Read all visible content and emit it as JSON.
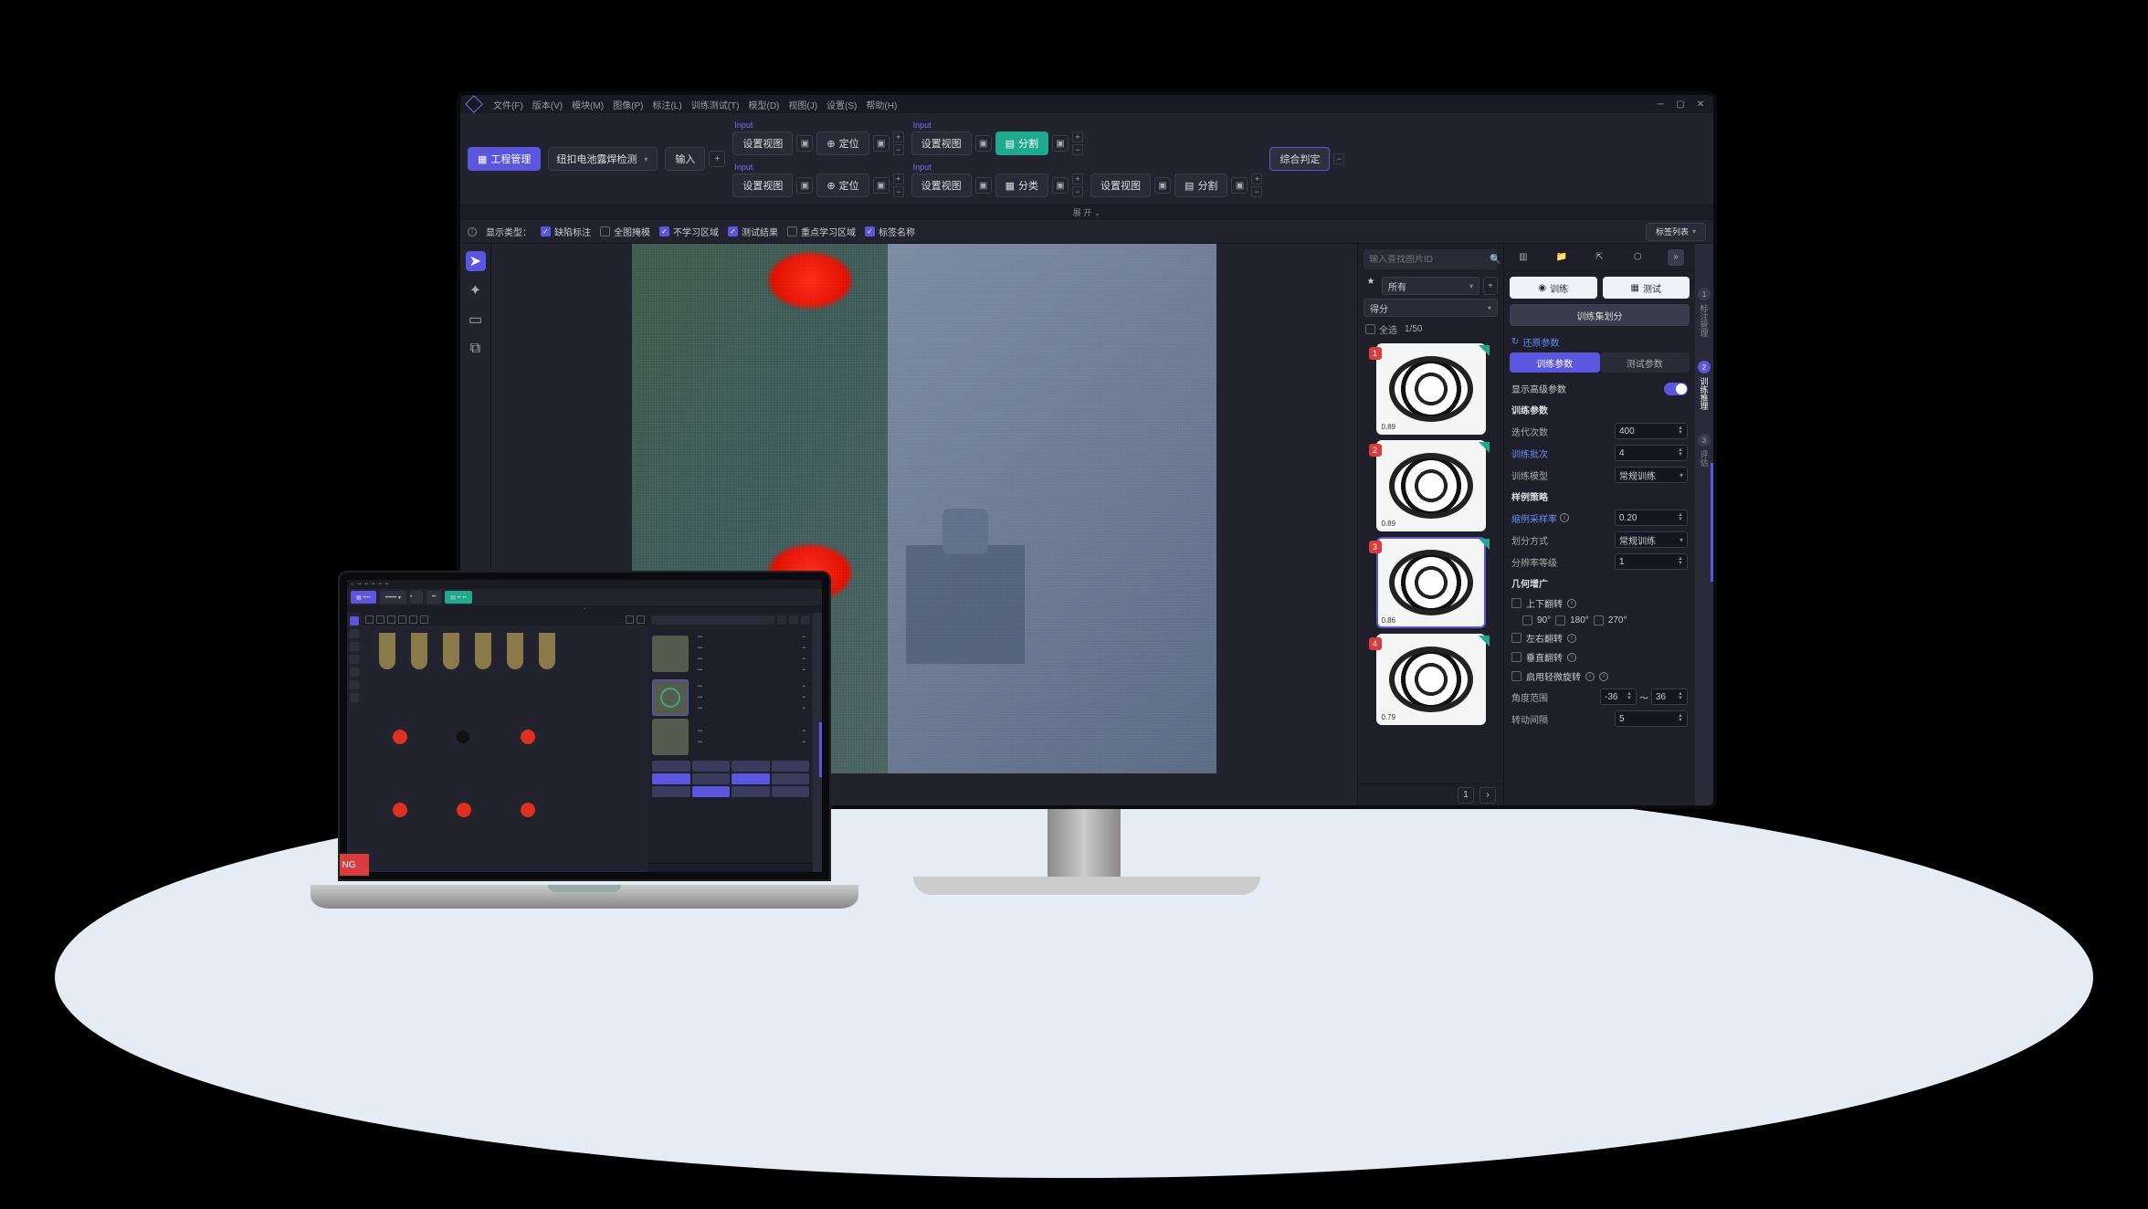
{
  "menu": {
    "items": [
      "文件(F)",
      "版本(V)",
      "模块(M)",
      "图像(P)",
      "标注(L)",
      "训练测试(T)",
      "模型(D)",
      "视图(J)",
      "设置(S)",
      "帮助(H)"
    ]
  },
  "pipeline": {
    "project_mgmt": "工程管理",
    "project_name": "纽扣电池露焊检测",
    "input": "输入",
    "set_view": "设置视图",
    "locate": "定位",
    "segment": "分割",
    "classify": "分类",
    "overall": "综合判定",
    "expand": "展 开 ⌄",
    "node_input": "Input"
  },
  "filters": {
    "label": "显示类型：",
    "defect": "缺陷标注",
    "mask": "全图掩模",
    "no_learn": "不学习区域",
    "result": "测试结果",
    "focus": "重点学习区域",
    "tag": "标签名称",
    "tag_list": "标签列表"
  },
  "thumbs": {
    "search_ph": "输入查找图片ID",
    "star": "所有",
    "score": "得分",
    "select_all": "全选",
    "count": "1/50",
    "items": [
      {
        "idx": "1",
        "score": "0.89"
      },
      {
        "idx": "2",
        "score": "0.89"
      },
      {
        "idx": "3",
        "score": "0.86"
      },
      {
        "idx": "4",
        "score": "0.79"
      }
    ],
    "page": "1"
  },
  "rpanel": {
    "train": "训练",
    "test": "测试",
    "split": "训练集划分",
    "restore": "还原参数",
    "tab_train": "训练参数",
    "tab_test": "测试参数",
    "adv": "显示高级参数",
    "s_train": "训练参数",
    "iter": "迭代次数",
    "iter_v": "400",
    "batch": "训练批次",
    "batch_v": "4",
    "model": "训练模型",
    "model_v": "常规训练",
    "s_sample": "样例策略",
    "sample_rate": "缩例采样率",
    "sample_rate_v": "0.20",
    "split_mode": "划分方式",
    "split_mode_v": "常规训练",
    "res_level": "分辨率等级",
    "res_level_v": "1",
    "s_geo": "几何增广",
    "flip_ud": "上下翻转",
    "r90": "90°",
    "r180": "180°",
    "r270": "270°",
    "flip_lr": "左右翻转",
    "flip_v": "垂直翻转",
    "micro_rot": "启用轻微旋转",
    "angle_range": "角度范围",
    "angle_min": "-36",
    "angle_sep": "～",
    "angle_max": "36",
    "step": "转动间隔",
    "step_v": "5"
  },
  "rnav": {
    "a": "标注管理",
    "b": "训练推理",
    "c": "评估"
  },
  "laptop": {
    "ng": "NG"
  }
}
